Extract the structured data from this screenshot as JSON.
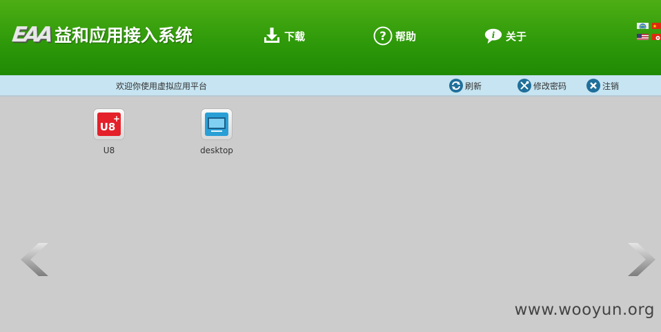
{
  "header": {
    "logo_mark": "EAA",
    "title": "益和应用接入系统",
    "nav": [
      {
        "label": "下载",
        "icon": "download-icon"
      },
      {
        "label": "帮助",
        "icon": "help-icon"
      },
      {
        "label": "关于",
        "icon": "info-icon"
      }
    ],
    "languages": [
      "globe",
      "cn-flag",
      "us-flag",
      "hk-flag"
    ]
  },
  "toolbar": {
    "welcome": "欢迎你使用虚拟应用平台",
    "refresh": "刷新",
    "change_password": "修改密码",
    "logout": "注销"
  },
  "apps": [
    {
      "label": "U8",
      "icon": "u8-app-icon"
    },
    {
      "label": "desktop",
      "icon": "desktop-app-icon"
    }
  ],
  "watermark": "www.wooyun.org",
  "colors": {
    "header_green": "#2f9a0a",
    "toolbar_blue": "#c6e4f1",
    "background": "#cccccc"
  }
}
